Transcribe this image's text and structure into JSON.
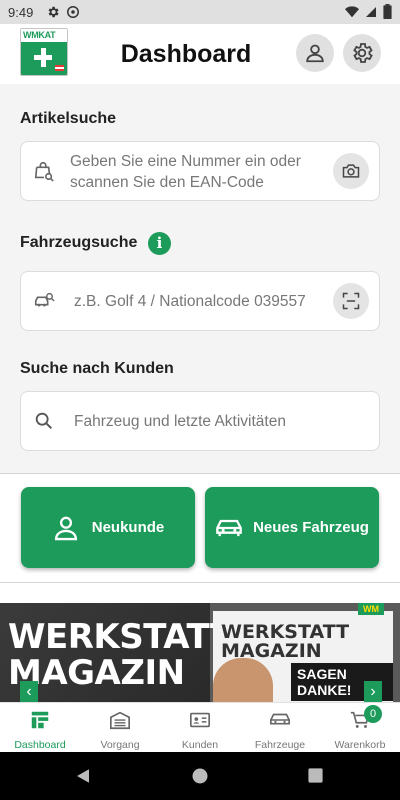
{
  "status_bar": {
    "time": "9:49"
  },
  "header": {
    "logo_text_wm": "WM",
    "logo_text_kat": "KAT",
    "title": "Dashboard"
  },
  "article_search": {
    "label": "Artikelsuche",
    "placeholder_line1": "Geben Sie eine Nummer ein oder",
    "placeholder_line2": "scannen Sie den EAN-Code"
  },
  "vehicle_search": {
    "label": "Fahrzeugsuche",
    "info_badge": "i",
    "placeholder": "z.B. Golf 4 / Nationalcode 039557"
  },
  "customer_search": {
    "label": "Suche nach Kunden",
    "placeholder": "Fahrzeug und letzte Aktivitäten"
  },
  "actions": {
    "new_customer": "Neukunde",
    "new_vehicle": "Neues Fahrzeug"
  },
  "banner": {
    "line1": "WERKSTATT",
    "line2": "MAGAZIN",
    "magazine_title_1": "WERKSTATT",
    "magazine_title_2": "MAGAZIN",
    "magazine_subtitle": "SAGEN DANKE!",
    "wm_mark": "WM"
  },
  "bottom_nav": {
    "items": [
      {
        "label": "Dashboard",
        "icon": "dashboard-icon",
        "active": true
      },
      {
        "label": "Vorgang",
        "icon": "garage-icon"
      },
      {
        "label": "Kunden",
        "icon": "id-card-icon"
      },
      {
        "label": "Fahrzeuge",
        "icon": "car-icon"
      },
      {
        "label": "Warenkorb",
        "icon": "cart-icon"
      }
    ],
    "cart_count": "0"
  },
  "colors": {
    "brand_green": "#1c9b5a",
    "background": "#f4f4f4"
  }
}
